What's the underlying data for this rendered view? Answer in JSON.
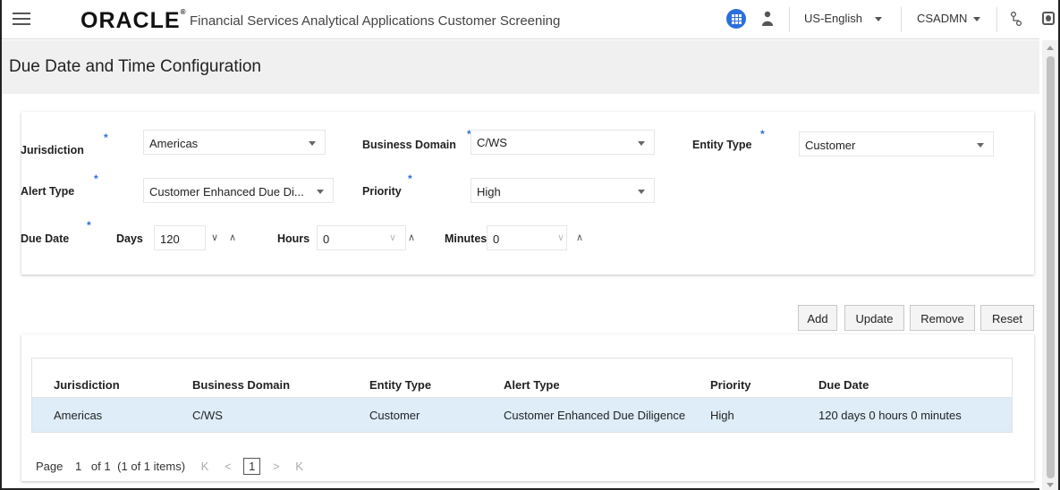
{
  "header": {
    "logo": "ORACLE",
    "app_title": "Financial Services Analytical Applications Customer Screening",
    "language": "US-English",
    "user": "CSADMN"
  },
  "page": {
    "title": "Due Date and Time Configuration"
  },
  "form": {
    "required_mark": "*",
    "jurisdiction": {
      "label": "Jurisdiction",
      "value": "Americas"
    },
    "business_domain": {
      "label": "Business Domain",
      "value": "C/WS"
    },
    "entity_type": {
      "label": "Entity Type",
      "value": "Customer"
    },
    "alert_type": {
      "label": "Alert Type",
      "value": "Customer Enhanced Due Di..."
    },
    "priority": {
      "label": "Priority",
      "value": "High"
    },
    "due_date": {
      "label": "Due Date",
      "days_label": "Days",
      "days_value": "120",
      "hours_label": "Hours",
      "hours_value": "0",
      "minutes_label": "Minutes",
      "minutes_value": "0"
    },
    "spin_down": "∨",
    "spin_up": "∧"
  },
  "actions": {
    "add": "Add",
    "update": "Update",
    "remove": "Remove",
    "reset": "Reset"
  },
  "table": {
    "columns": [
      "Jurisdiction",
      "Business Domain",
      "Entity Type",
      "Alert Type",
      "Priority",
      "Due Date"
    ],
    "rows": [
      [
        "Americas",
        "C/WS",
        "Customer",
        "Customer Enhanced Due Diligence",
        "High",
        "120 days 0 hours 0 minutes"
      ]
    ]
  },
  "pager": {
    "page_label": "Page",
    "page_value": "1",
    "of_text": "of 1",
    "items_text": "(1 of 1 items)",
    "first": "K",
    "prev": "<",
    "current": "1",
    "next": ">",
    "last": "K"
  },
  "colors": {
    "accent": "#2a6fdb",
    "row_selected": "#deedf8",
    "page_head_bg": "#f0f0f0"
  }
}
